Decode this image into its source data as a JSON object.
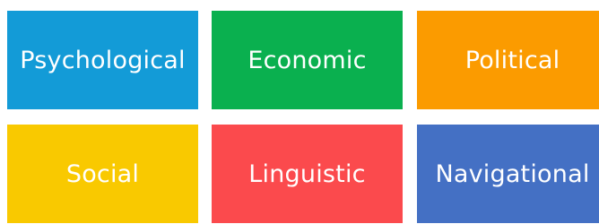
{
  "tiles": [
    {
      "label": "Psychological",
      "color": "#139bd7"
    },
    {
      "label": "Economic",
      "color": "#0ab04f"
    },
    {
      "label": "Political",
      "color": "#fb9b00"
    },
    {
      "label": "Social",
      "color": "#f9c900"
    },
    {
      "label": "Linguistic",
      "color": "#fb4a4d"
    },
    {
      "label": "Navigational",
      "color": "#4470c4"
    }
  ]
}
